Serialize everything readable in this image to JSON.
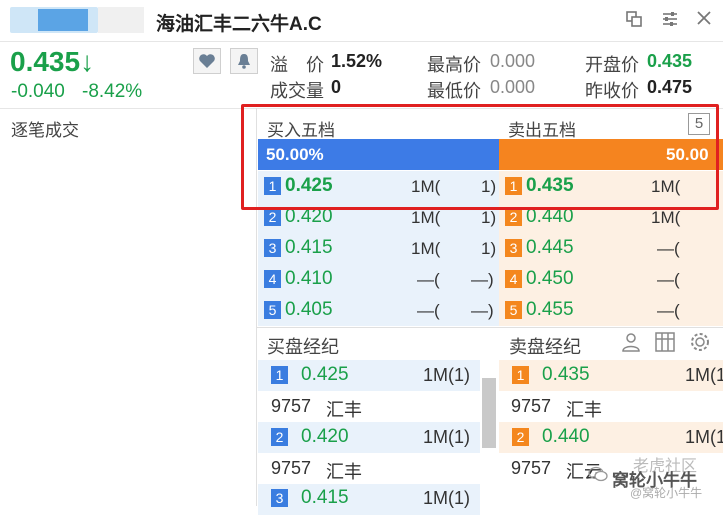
{
  "header": {
    "title": "海油汇丰二六牛A.C"
  },
  "quote": {
    "price": "0.435",
    "arrow": "↓",
    "change": "-0.040",
    "change_pct": "-8.42%"
  },
  "stats": {
    "premium_label": "溢　价",
    "premium_value": "1.52%",
    "high_label": "最高价",
    "high_value": "0.000",
    "open_label": "开盘价",
    "open_value": "0.435",
    "volume_label": "成交量",
    "volume_value": "0",
    "low_label": "最低价",
    "low_value": "0.000",
    "prev_close_label": "昨收价",
    "prev_close_value": "0.475"
  },
  "tick_label": "逐笔成交",
  "depth": {
    "bid_title": "买入五档",
    "ask_title": "卖出五档",
    "toggle_label": "5",
    "bid_pct": "50.00%",
    "ask_pct": "50.00",
    "bids": [
      {
        "level": "1",
        "price": "0.425",
        "vol": "1M(",
        "count": "1)"
      },
      {
        "level": "2",
        "price": "0.420",
        "vol": "1M(",
        "count": "1)"
      },
      {
        "level": "3",
        "price": "0.415",
        "vol": "1M(",
        "count": "1)"
      },
      {
        "level": "4",
        "price": "0.410",
        "vol": "—(",
        "count": "—)"
      },
      {
        "level": "5",
        "price": "0.405",
        "vol": "—(",
        "count": "—)"
      }
    ],
    "asks": [
      {
        "level": "1",
        "price": "0.435",
        "vol": "1M("
      },
      {
        "level": "2",
        "price": "0.440",
        "vol": "1M("
      },
      {
        "level": "3",
        "price": "0.445",
        "vol": "—("
      },
      {
        "level": "4",
        "price": "0.450",
        "vol": "—("
      },
      {
        "level": "5",
        "price": "0.455",
        "vol": "—("
      }
    ]
  },
  "brokers": {
    "bid_title": "买盘经纪",
    "ask_title": "卖盘经纪",
    "bid_rows": [
      {
        "level": "1",
        "price": "0.425",
        "vol": "1M(1)"
      },
      {
        "broker_id": "9757",
        "broker_name": "汇丰"
      },
      {
        "level": "2",
        "price": "0.420",
        "vol": "1M(1)"
      },
      {
        "broker_id": "9757",
        "broker_name": "汇丰"
      },
      {
        "level": "3",
        "price": "0.415",
        "vol": "1M(1)"
      }
    ],
    "ask_rows": [
      {
        "level": "1",
        "price": "0.435",
        "vol": "1M(1"
      },
      {
        "broker_id": "9757",
        "broker_name": "汇丰"
      },
      {
        "level": "2",
        "price": "0.440",
        "vol": "1M(1"
      },
      {
        "broker_id": "9757",
        "broker_name": "汇云"
      }
    ]
  },
  "watermark": {
    "line1": "老虎社区",
    "line2": "窝轮小牛牛",
    "line3": "@窝轮小牛牛"
  },
  "colors": {
    "down_green": "#1aa04a",
    "bid_blue": "#3d7be6",
    "ask_orange": "#f5841f",
    "highlight_red": "#e02020"
  }
}
